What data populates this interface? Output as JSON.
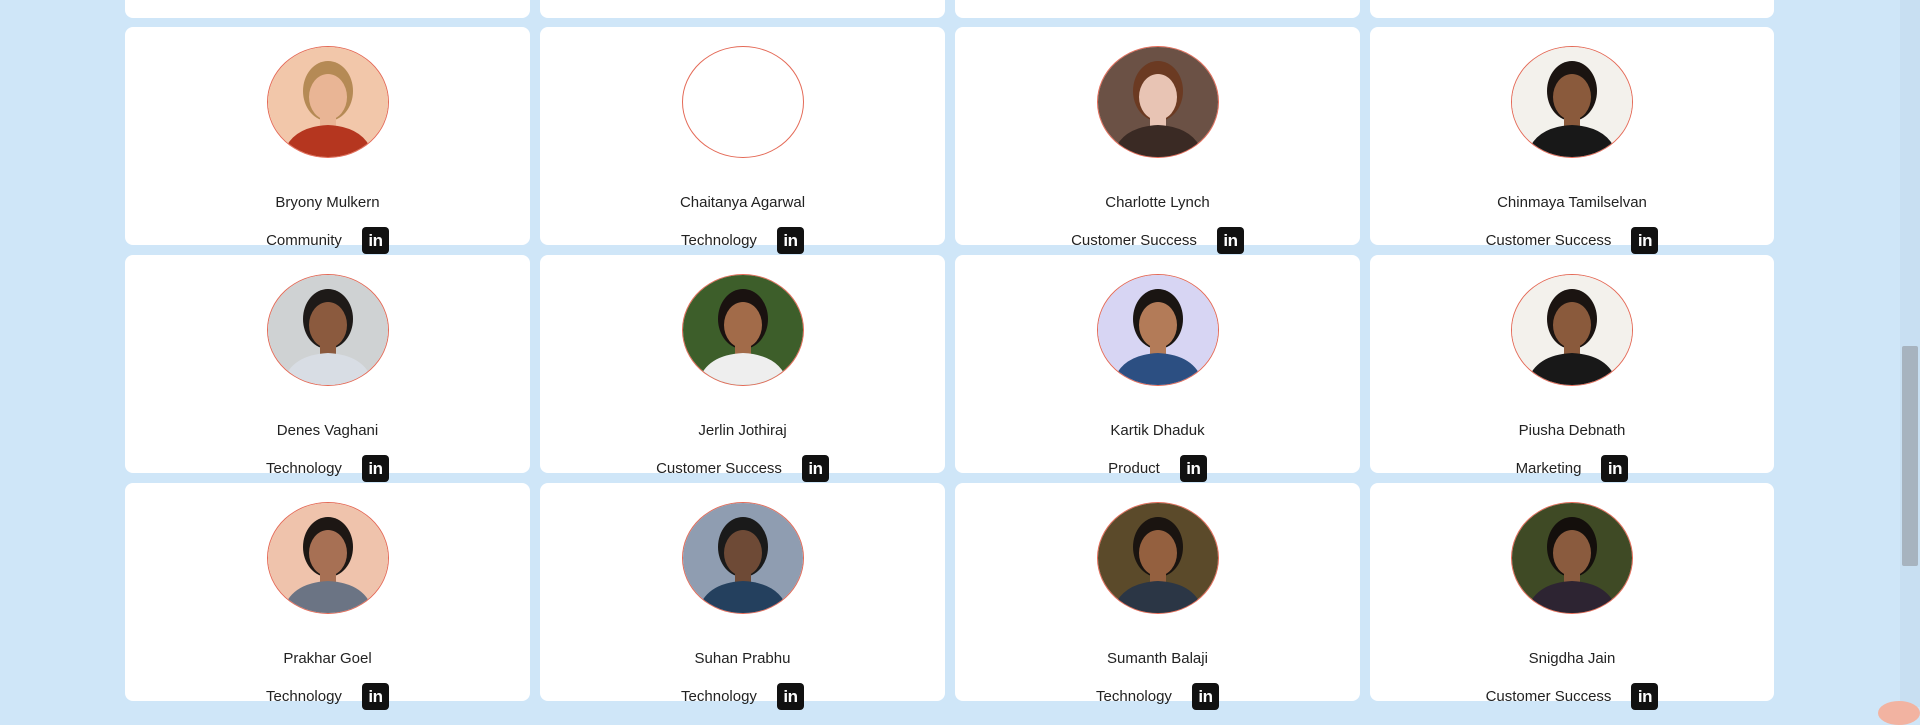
{
  "team": [
    {
      "name": "Bryony Mulkern",
      "dept": "Community",
      "photo": "warm"
    },
    {
      "name": "Chaitanya Agarwal",
      "dept": "Technology",
      "photo": "empty"
    },
    {
      "name": "Charlotte Lynch",
      "dept": "Customer Success",
      "photo": "brown"
    },
    {
      "name": "Chinmaya Tamilselvan",
      "dept": "Customer Success",
      "photo": "light"
    },
    {
      "name": "Denes Vaghani",
      "dept": "Technology",
      "photo": "grey"
    },
    {
      "name": "Jerlin Jothiraj",
      "dept": "Customer Success",
      "photo": "grass"
    },
    {
      "name": "Kartik Dhaduk",
      "dept": "Product",
      "photo": "lavender"
    },
    {
      "name": "Piusha Debnath",
      "dept": "Marketing",
      "photo": "light"
    },
    {
      "name": "Prakhar Goel",
      "dept": "Technology",
      "photo": "peach"
    },
    {
      "name": "Suhan Prabhu",
      "dept": "Technology",
      "photo": "city"
    },
    {
      "name": "Sumanth Balaji",
      "dept": "Technology",
      "photo": "olive"
    },
    {
      "name": "Snigdha Jain",
      "dept": "Customer Success",
      "photo": "leaves"
    }
  ],
  "linkedin_label": "in",
  "icons": {
    "social": "linkedin-icon"
  },
  "colors": {
    "background": "#cfe6f8",
    "card": "#ffffff",
    "avatar_border": "#e46a57",
    "linkedin": "#111111"
  }
}
